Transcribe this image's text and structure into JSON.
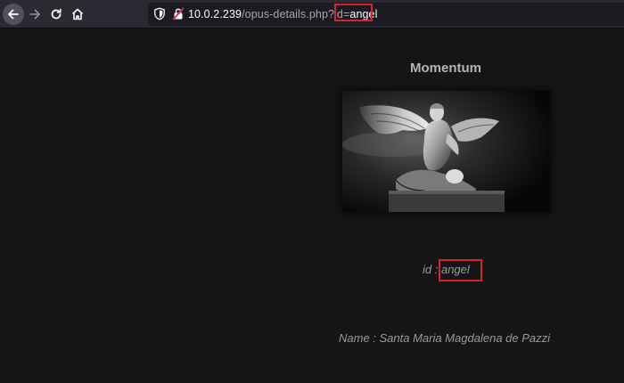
{
  "browser": {
    "url": {
      "host": "10.0.2.239",
      "path": "/opus-details.php?id=",
      "param_value": "angel"
    },
    "icons": {
      "back": "arrow-left-icon",
      "forward": "arrow-right-icon",
      "reload": "reload-icon",
      "home": "home-icon",
      "shield": "shield-icon",
      "insecure": "insecure-lock-icon"
    }
  },
  "page": {
    "title": "Momentum",
    "image_alt": "angel statue",
    "id_label": "id : ",
    "id_value": "angel",
    "name_label": "Name : ",
    "name_value": "Santa Maria Magdalena de Pazzi"
  },
  "colors": {
    "highlight": "#d8232f",
    "background": "#151515",
    "toolbar": "#2b2a33"
  }
}
